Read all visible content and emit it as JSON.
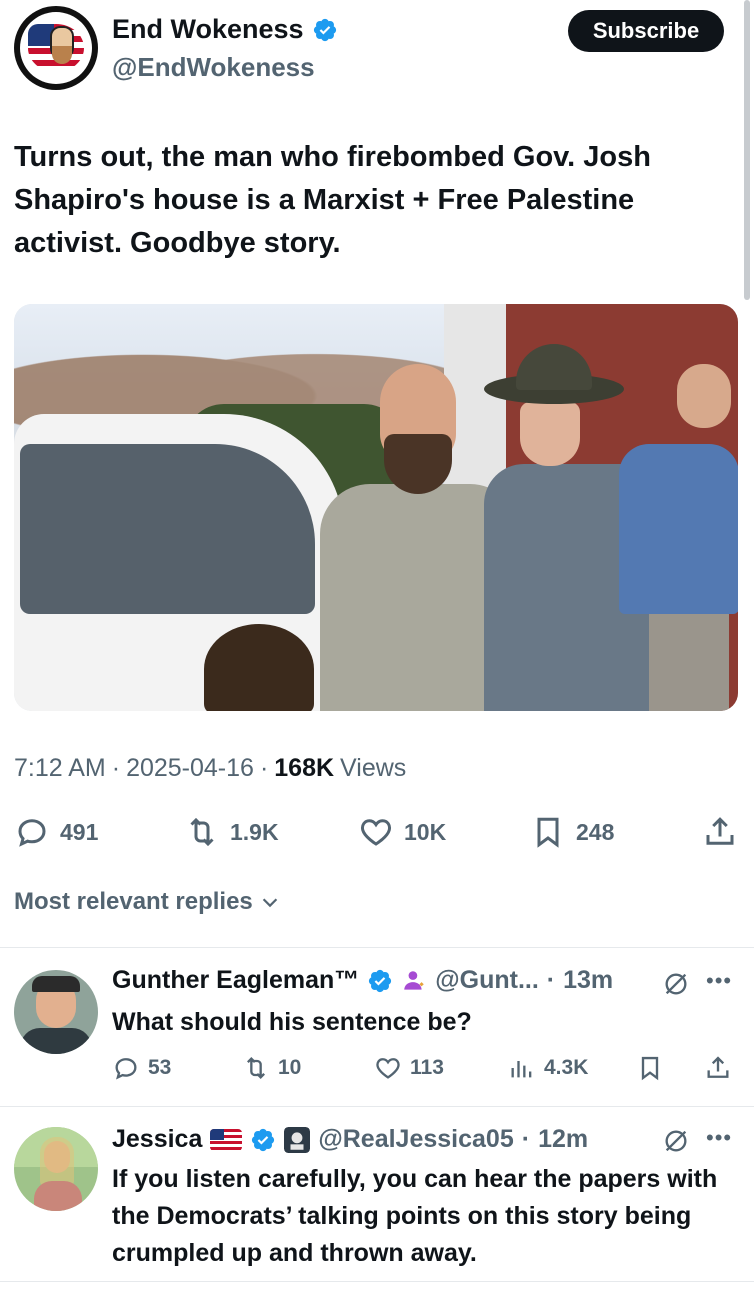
{
  "author": {
    "display_name": "End Wokeness",
    "handle": "@EndWokeness",
    "verified": true
  },
  "header": {
    "subscribe_label": "Subscribe"
  },
  "tweet": {
    "text": "Turns out, the man who firebombed Gov. Josh Shapiro's house is a Marxist + Free Palestine activist. Goodbye story.",
    "time": "7:12 AM",
    "date": "2025-04-16",
    "views_count": "168K",
    "views_label": "Views",
    "separator": "·",
    "stats": {
      "replies": "491",
      "reposts": "1.9K",
      "likes": "10K",
      "bookmarks": "248"
    }
  },
  "replies_sort": {
    "label": "Most relevant replies"
  },
  "replies": [
    {
      "name": "Gunther Eagleman™",
      "handle": "@Gunt...",
      "time": "13m",
      "text": "What should his sentence be?",
      "stats": {
        "replies": "53",
        "reposts": "10",
        "likes": "113",
        "views": "4.3K"
      }
    },
    {
      "name": "Jessica",
      "handle": "@RealJessica05",
      "time": "12m",
      "text": "If you listen carefully, you can hear the papers with the Democrats’ talking points on this story being crumpled up and thrown away."
    }
  ],
  "icons": {
    "verified": "verified-badge-icon",
    "reply": "reply-bubble-icon",
    "repost": "repost-icon",
    "like": "heart-icon",
    "bookmark": "bookmark-icon",
    "share": "share-icon",
    "views": "views-bar-icon",
    "grok": "grok-icon",
    "more": "more-icon",
    "chevron": "chevron-down-icon"
  },
  "colors": {
    "accent": "#1d9bf0",
    "text_primary": "#0f1419",
    "text_secondary": "#536471",
    "button_dark": "#0f1419"
  }
}
